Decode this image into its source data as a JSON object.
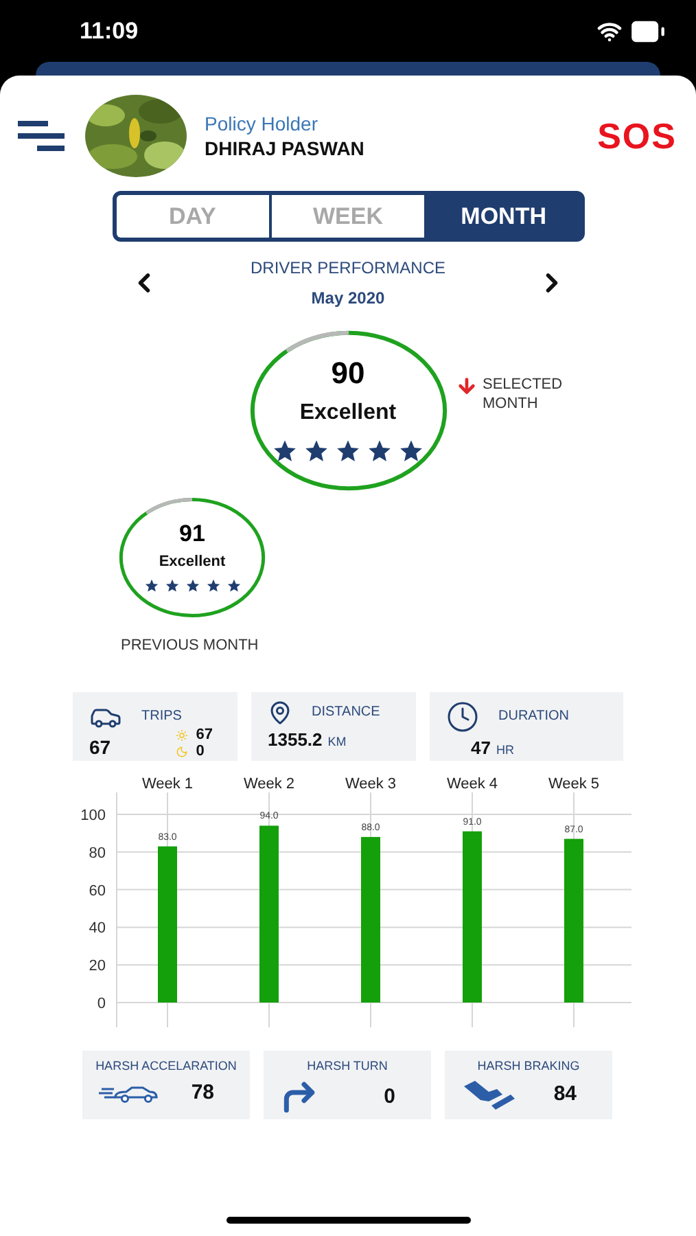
{
  "status_bar": {
    "time": "11:09"
  },
  "header": {
    "role": "Policy Holder",
    "name": "DHIRAJ PASWAN",
    "sos": "SOS"
  },
  "tabs": [
    {
      "label": "DAY",
      "selected": false
    },
    {
      "label": "WEEK",
      "selected": false
    },
    {
      "label": "MONTH",
      "selected": true
    }
  ],
  "period": {
    "title": "DRIVER PERFORMANCE",
    "value": "May 2020"
  },
  "current_score": {
    "score": "90",
    "rating": "Excellent",
    "stars": 5,
    "note": "SELECTED MONTH"
  },
  "previous_score": {
    "score": "91",
    "rating": "Excellent",
    "stars": 5,
    "caption": "PREVIOUS MONTH"
  },
  "stats": [
    {
      "kind": "trips",
      "label": "TRIPS",
      "value": "67",
      "day": "67",
      "night": "0"
    },
    {
      "kind": "distance",
      "label": "DISTANCE",
      "value": "1355.2",
      "unit": "KM"
    },
    {
      "kind": "duration",
      "label": "DURATION",
      "value": "47",
      "unit": "HR"
    }
  ],
  "weekly_chart": {
    "chart_data": {
      "type": "bar",
      "grid": true,
      "categories": [
        "Week 1",
        "Week 2",
        "Week 3",
        "Week 4",
        "Week 5"
      ],
      "values": [
        83,
        94,
        88,
        91,
        87
      ],
      "ylim": [
        0,
        100
      ],
      "yticks": [
        0,
        20,
        40,
        60,
        80,
        100
      ],
      "value_labels": [
        "83.0",
        "94.0",
        "88.0",
        "91.0",
        "87.0"
      ]
    }
  },
  "events": [
    {
      "kind": "acceleration",
      "label": "HARSH ACCELARATION",
      "value": "78"
    },
    {
      "kind": "turn",
      "label": "HARSH TURN",
      "value": "0"
    },
    {
      "kind": "braking",
      "label": "HARSH BRAKING",
      "value": "84"
    }
  ]
}
